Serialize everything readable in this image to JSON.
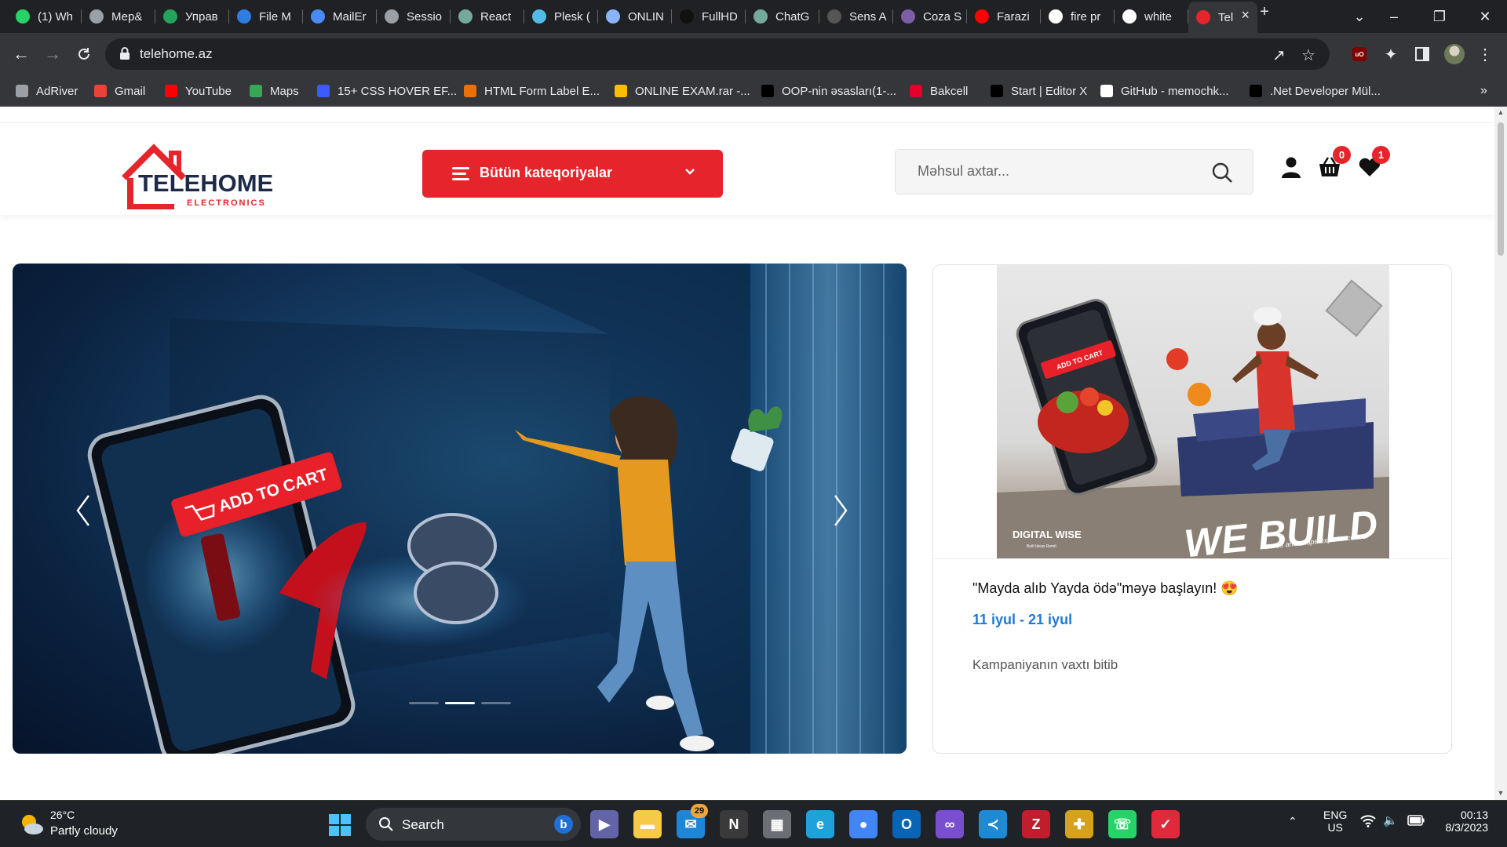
{
  "browser": {
    "tabs": [
      {
        "label": "(1) Wh",
        "icon": "whatsapp-icon",
        "color": "#25d366"
      },
      {
        "label": "Мер&",
        "icon": "globe-icon",
        "color": "#9aa0a6"
      },
      {
        "label": "Управ",
        "icon": "green-s-icon",
        "color": "#22a45d"
      },
      {
        "label": "File M",
        "icon": "s-file-icon",
        "color": "#2f7de1"
      },
      {
        "label": "MailEr",
        "icon": "mail-icon",
        "color": "#4a8af4"
      },
      {
        "label": "Sessio",
        "icon": "globe-icon",
        "color": "#9aa0a6"
      },
      {
        "label": "React",
        "icon": "openai-icon",
        "color": "#74aa9c"
      },
      {
        "label": "Plesk (",
        "icon": "plesk-icon",
        "color": "#53bce6"
      },
      {
        "label": "ONLIN",
        "icon": "globe-icon",
        "color": "#8ab4f8"
      },
      {
        "label": "FullHD",
        "icon": "film-icon",
        "color": "#111111"
      },
      {
        "label": "ChatG",
        "icon": "openai-icon",
        "color": "#74aa9c"
      },
      {
        "label": "Sens A",
        "icon": "dash-icon",
        "color": "#555555"
      },
      {
        "label": "Coza S",
        "icon": "coza-icon",
        "color": "#7b5ea7"
      },
      {
        "label": "Farazi",
        "icon": "youtube-icon",
        "color": "#ff0000"
      },
      {
        "label": "fire pr",
        "icon": "google-icon",
        "color": "#ffffff"
      },
      {
        "label": "white",
        "icon": "google-icon",
        "color": "#ffffff"
      },
      {
        "label": "Tel",
        "icon": "telehome-icon",
        "color": "#e5242b",
        "active": true
      }
    ],
    "new_tab": "+",
    "url": "telehome.az",
    "bookmarks": [
      {
        "label": "AdRiver",
        "icon": "globe-icon",
        "color": "#9aa0a6"
      },
      {
        "label": "Gmail",
        "icon": "gmail-icon",
        "color": "#ea4335"
      },
      {
        "label": "YouTube",
        "icon": "youtube-icon",
        "color": "#ff0000"
      },
      {
        "label": "Maps",
        "icon": "maps-pin-icon",
        "color": "#34a853"
      },
      {
        "label": "15+ CSS HOVER EF...",
        "icon": "css-icon",
        "color": "#3d5afe"
      },
      {
        "label": "HTML Form Label E...",
        "icon": "globe-orange-icon",
        "color": "#e8710a"
      },
      {
        "label": "ONLINE EXAM.rar -...",
        "icon": "drive-icon",
        "color": "#fbbc04"
      },
      {
        "label": "OOP-nin əsasları(1-...",
        "icon": "medium-icon",
        "color": "#000000"
      },
      {
        "label": "Bakcell",
        "icon": "bakcell-icon",
        "color": "#e4002b"
      },
      {
        "label": "Start | Editor X",
        "icon": "editorx-icon",
        "color": "#000000"
      },
      {
        "label": "GitHub - memochk...",
        "icon": "github-icon",
        "color": "#ffffff"
      },
      {
        "label": ".Net Developer Mül...",
        "icon": "m-icon",
        "color": "#000000"
      }
    ],
    "bookmarks_more": "»",
    "extension_badge": "uO"
  },
  "site": {
    "logo_text": "TELEHOME",
    "logo_sub": "ELECTRONICS",
    "categories_label": "Bütün kateqoriyalar",
    "search_placeholder": "Məhsul axtar...",
    "cart_count": "0",
    "wishlist_count": "1",
    "hero": {
      "cart_text": "ADD TO CART",
      "slide_count": 3,
      "active_slide": 2
    },
    "promo": {
      "image_text_big": "WE BUILD",
      "image_text_small": "stores and shape experience tool",
      "image_brand": "DIGITAL WISE",
      "image_brand_sub": "Built Ideas Remit",
      "image_cart_text": "ADD TO CART",
      "title": "\"Mayda alıb Yayda ödə\"məyə başlayın! 😍",
      "date_range": "11 iyul - 21 iyul",
      "status": "Kampaniyanın vaxtı bitib"
    }
  },
  "taskbar": {
    "weather_temp": "26°C",
    "weather_desc": "Partly cloudy",
    "search_label": "Search",
    "mail_badge": "29",
    "lang_top": "ENG",
    "lang_bottom": "US",
    "time": "00:13",
    "date": "8/3/2023"
  },
  "colors": {
    "brand_red": "#e5242b",
    "link_blue": "#1d7ad6",
    "chrome_dark": "#202124",
    "chrome_toolbar": "#35363a"
  }
}
